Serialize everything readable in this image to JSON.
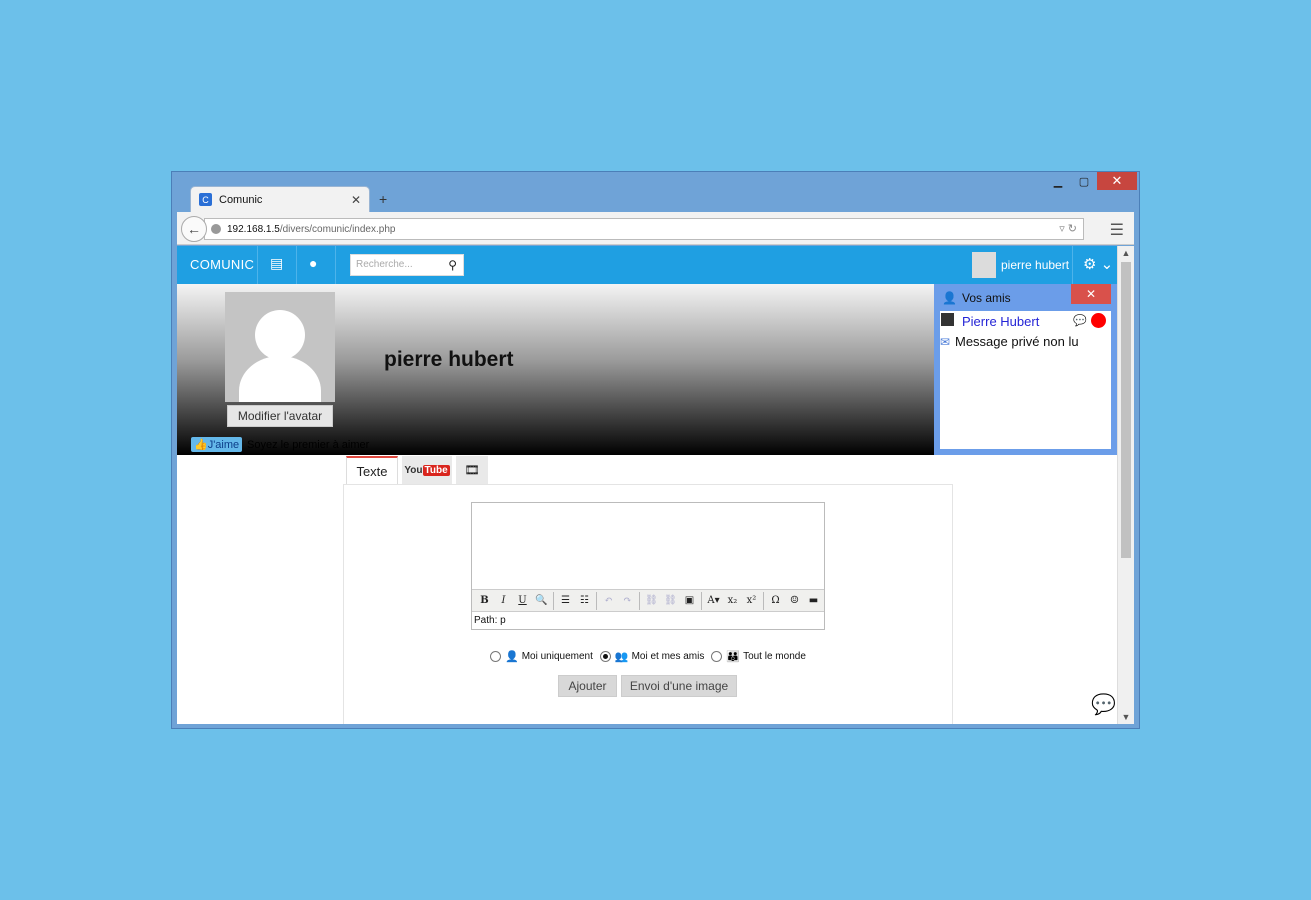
{
  "browser": {
    "tab_title": "Comunic",
    "tab_favicon_letter": "C",
    "new_tab": "+",
    "url_host": "192.168.1.5",
    "url_path": "/divers/comunic/index.php"
  },
  "appbar": {
    "brand": "COMUNIC",
    "search_placeholder": "Recherche...",
    "username": "pierre hubert"
  },
  "profile": {
    "name": "pierre hubert",
    "modify_avatar": "Modifier l'avatar",
    "like_label": "J'aime",
    "like_text": "Soyez le premier à aimer"
  },
  "friends": {
    "title": "Vos amis",
    "close": "✕",
    "friend_name": "Pierre Hubert",
    "unread_message": "Message privé non lu",
    "status_color": "#ff0000"
  },
  "composer": {
    "tabs": {
      "text": "Texte",
      "youtube_a": "You",
      "youtube_b": "Tube"
    },
    "path": "Path: p",
    "visibility": {
      "private": "Moi uniquement",
      "friends": "Moi et mes amis",
      "public": "Tout le monde"
    },
    "add_button": "Ajouter",
    "image_button": "Envoi d'une image"
  },
  "colors": {
    "accent": "#1f9fe2",
    "window_frame": "#6fa3d7",
    "background": "#6cc0ea"
  }
}
